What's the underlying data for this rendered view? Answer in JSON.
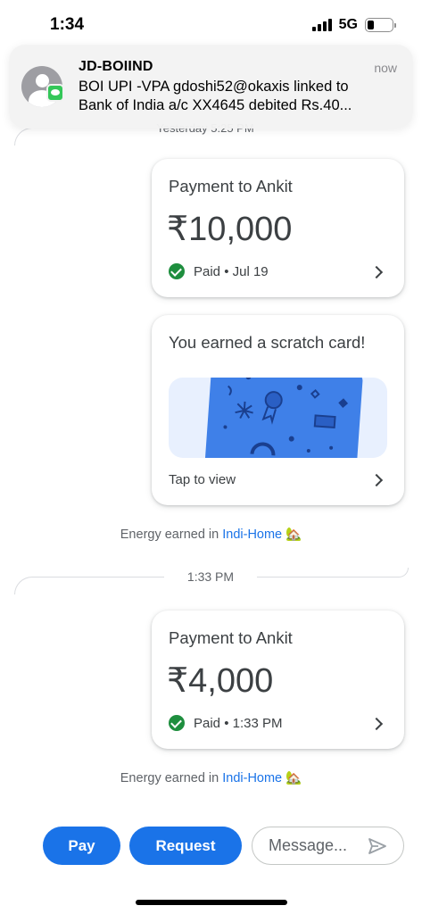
{
  "status_bar": {
    "time": "1:34",
    "network": "5G"
  },
  "notification": {
    "sender": "JD-BOIIND",
    "time": "now",
    "line1": "BOI UPI -VPA gdoshi52@okaxis linked to",
    "line2": "Bank of India a/c XX4645 debited Rs.40..."
  },
  "chat": {
    "separator_top": "Yesterday 5:25 PM",
    "payment1": {
      "title": "Payment to Ankit",
      "amount": "₹10,000",
      "status": "Paid • Jul 19"
    },
    "scratch": {
      "title": "You earned a scratch card!",
      "action": "Tap to view"
    },
    "energy1": {
      "prefix": "Energy earned in ",
      "link": "Indi-Home",
      "emoji": "🏡"
    },
    "separator_time": "1:33 PM",
    "payment2": {
      "title": "Payment to Ankit",
      "amount": "₹4,000",
      "status": "Paid • 1:33 PM"
    },
    "energy2": {
      "prefix": "Energy earned in ",
      "link": "Indi-Home",
      "emoji": "🏡"
    }
  },
  "bottom_bar": {
    "pay_label": "Pay",
    "request_label": "Request",
    "message_placeholder": "Message..."
  },
  "colors": {
    "accent": "#1a73e8",
    "success": "#1e8e3e",
    "scratch_card": "#3f80e8"
  }
}
